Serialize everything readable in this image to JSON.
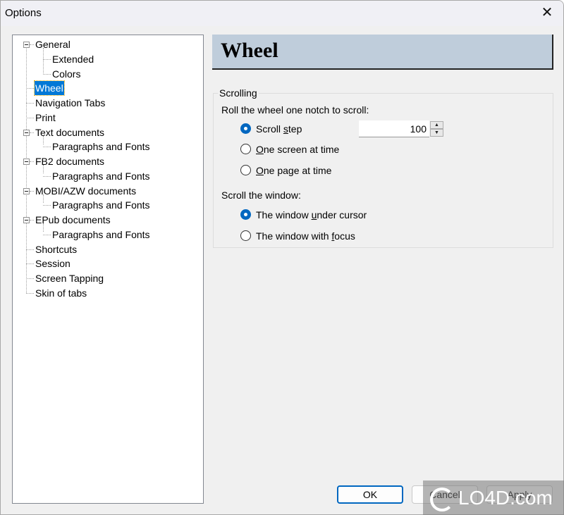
{
  "window": {
    "title": "Options",
    "close_icon": "close-icon"
  },
  "tree": {
    "items": [
      {
        "label": "General",
        "level": 0,
        "expandable": true,
        "expanded": true
      },
      {
        "label": "Extended",
        "level": 1
      },
      {
        "label": "Colors",
        "level": 1
      },
      {
        "label": "Wheel",
        "level": 0,
        "selected": true
      },
      {
        "label": "Navigation Tabs",
        "level": 0
      },
      {
        "label": "Print",
        "level": 0
      },
      {
        "label": "Text documents",
        "level": 0,
        "expandable": true,
        "expanded": true
      },
      {
        "label": "Paragraphs and Fonts",
        "level": 1
      },
      {
        "label": "FB2 documents",
        "level": 0,
        "expandable": true,
        "expanded": true
      },
      {
        "label": "Paragraphs and Fonts",
        "level": 1
      },
      {
        "label": "MOBI/AZW documents",
        "level": 0,
        "expandable": true,
        "expanded": true
      },
      {
        "label": "Paragraphs and Fonts",
        "level": 1
      },
      {
        "label": "EPub documents",
        "level": 0,
        "expandable": true,
        "expanded": true
      },
      {
        "label": "Paragraphs and Fonts",
        "level": 1
      },
      {
        "label": "Shortcuts",
        "level": 0
      },
      {
        "label": "Session",
        "level": 0
      },
      {
        "label": "Screen Tapping",
        "level": 0
      },
      {
        "label": "Skin of tabs",
        "level": 0
      }
    ]
  },
  "page": {
    "header": "Wheel",
    "group_title": "Scrolling",
    "scroll_prompt": "Roll the wheel one notch to scroll:",
    "scroll_options": [
      {
        "pre": "Scroll ",
        "accel": "s",
        "post": "tep",
        "checked": true
      },
      {
        "pre": "",
        "accel": "O",
        "post": "ne screen at time",
        "checked": false
      },
      {
        "pre": "",
        "accel": "O",
        "post": "ne page at time",
        "checked": false
      }
    ],
    "scroll_step_value": "100",
    "window_prompt": "Scroll the window:",
    "window_options": [
      {
        "pre": "The window ",
        "accel": "u",
        "post": "nder cursor",
        "checked": true
      },
      {
        "pre": "The window with ",
        "accel": "f",
        "post": "ocus",
        "checked": false
      }
    ]
  },
  "buttons": {
    "ok": "OK",
    "cancel": "Cancel",
    "apply": "Apply"
  },
  "watermark": "LO4D.com"
}
